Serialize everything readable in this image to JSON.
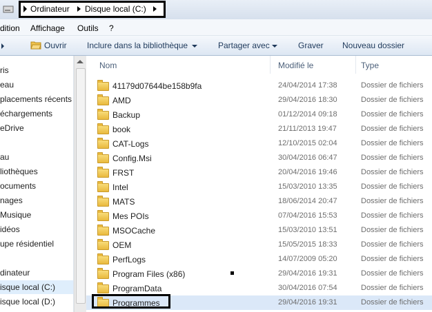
{
  "address_bar": {
    "crumbs": [
      "Ordinateur",
      "Disque local (C:)"
    ]
  },
  "menu": [
    "dition",
    "Affichage",
    "Outils",
    "?"
  ],
  "toolbar": {
    "open": "Ouvrir",
    "include": "Inclure dans la bibliothèque",
    "share": "Partager avec",
    "burn": "Graver",
    "new_folder": "Nouveau dossier"
  },
  "nav_items": [
    {
      "label": "ris"
    },
    {
      "label": "eau"
    },
    {
      "label": "placements récents"
    },
    {
      "label": "échargements"
    },
    {
      "label": "eDrive"
    },
    {
      "label": ""
    },
    {
      "label": "au"
    },
    {
      "label": "liothèques"
    },
    {
      "label": "ocuments"
    },
    {
      "label": "nages"
    },
    {
      "label": "Musique"
    },
    {
      "label": "idéos"
    },
    {
      "label": "upe résidentiel"
    },
    {
      "label": ""
    },
    {
      "label": "dinateur"
    },
    {
      "label": "isque local (C:)"
    },
    {
      "label": "isque local (D:)"
    }
  ],
  "columns": {
    "name": "Nom",
    "modified": "Modifié le",
    "type": "Type"
  },
  "files": [
    {
      "name": "41179d07644be158b9fa",
      "date": "24/04/2014 17:38",
      "type": "Dossier de fichiers"
    },
    {
      "name": "AMD",
      "date": "29/04/2016 18:30",
      "type": "Dossier de fichiers"
    },
    {
      "name": "Backup",
      "date": "01/12/2014 09:18",
      "type": "Dossier de fichiers"
    },
    {
      "name": "book",
      "date": "21/11/2013 19:47",
      "type": "Dossier de fichiers"
    },
    {
      "name": "CAT-Logs",
      "date": "12/10/2015 02:04",
      "type": "Dossier de fichiers"
    },
    {
      "name": "Config.Msi",
      "date": "30/04/2016 06:47",
      "type": "Dossier de fichiers"
    },
    {
      "name": "FRST",
      "date": "20/04/2016 19:46",
      "type": "Dossier de fichiers"
    },
    {
      "name": "Intel",
      "date": "15/03/2010 13:35",
      "type": "Dossier de fichiers"
    },
    {
      "name": "MATS",
      "date": "18/06/2014 20:47",
      "type": "Dossier de fichiers"
    },
    {
      "name": "Mes POIs",
      "date": "07/04/2016 15:53",
      "type": "Dossier de fichiers"
    },
    {
      "name": "MSOCache",
      "date": "15/03/2010 13:51",
      "type": "Dossier de fichiers"
    },
    {
      "name": "OEM",
      "date": "15/05/2015 18:33",
      "type": "Dossier de fichiers"
    },
    {
      "name": "PerfLogs",
      "date": "14/07/2009 05:20",
      "type": "Dossier de fichiers"
    },
    {
      "name": "Program Files (x86)",
      "date": "29/04/2016 19:31",
      "type": "Dossier de fichiers"
    },
    {
      "name": "ProgramData",
      "date": "30/04/2016 07:54",
      "type": "Dossier de fichiers"
    },
    {
      "name": "Programmes",
      "date": "29/04/2016 19:31",
      "type": "Dossier de fichiers"
    }
  ]
}
